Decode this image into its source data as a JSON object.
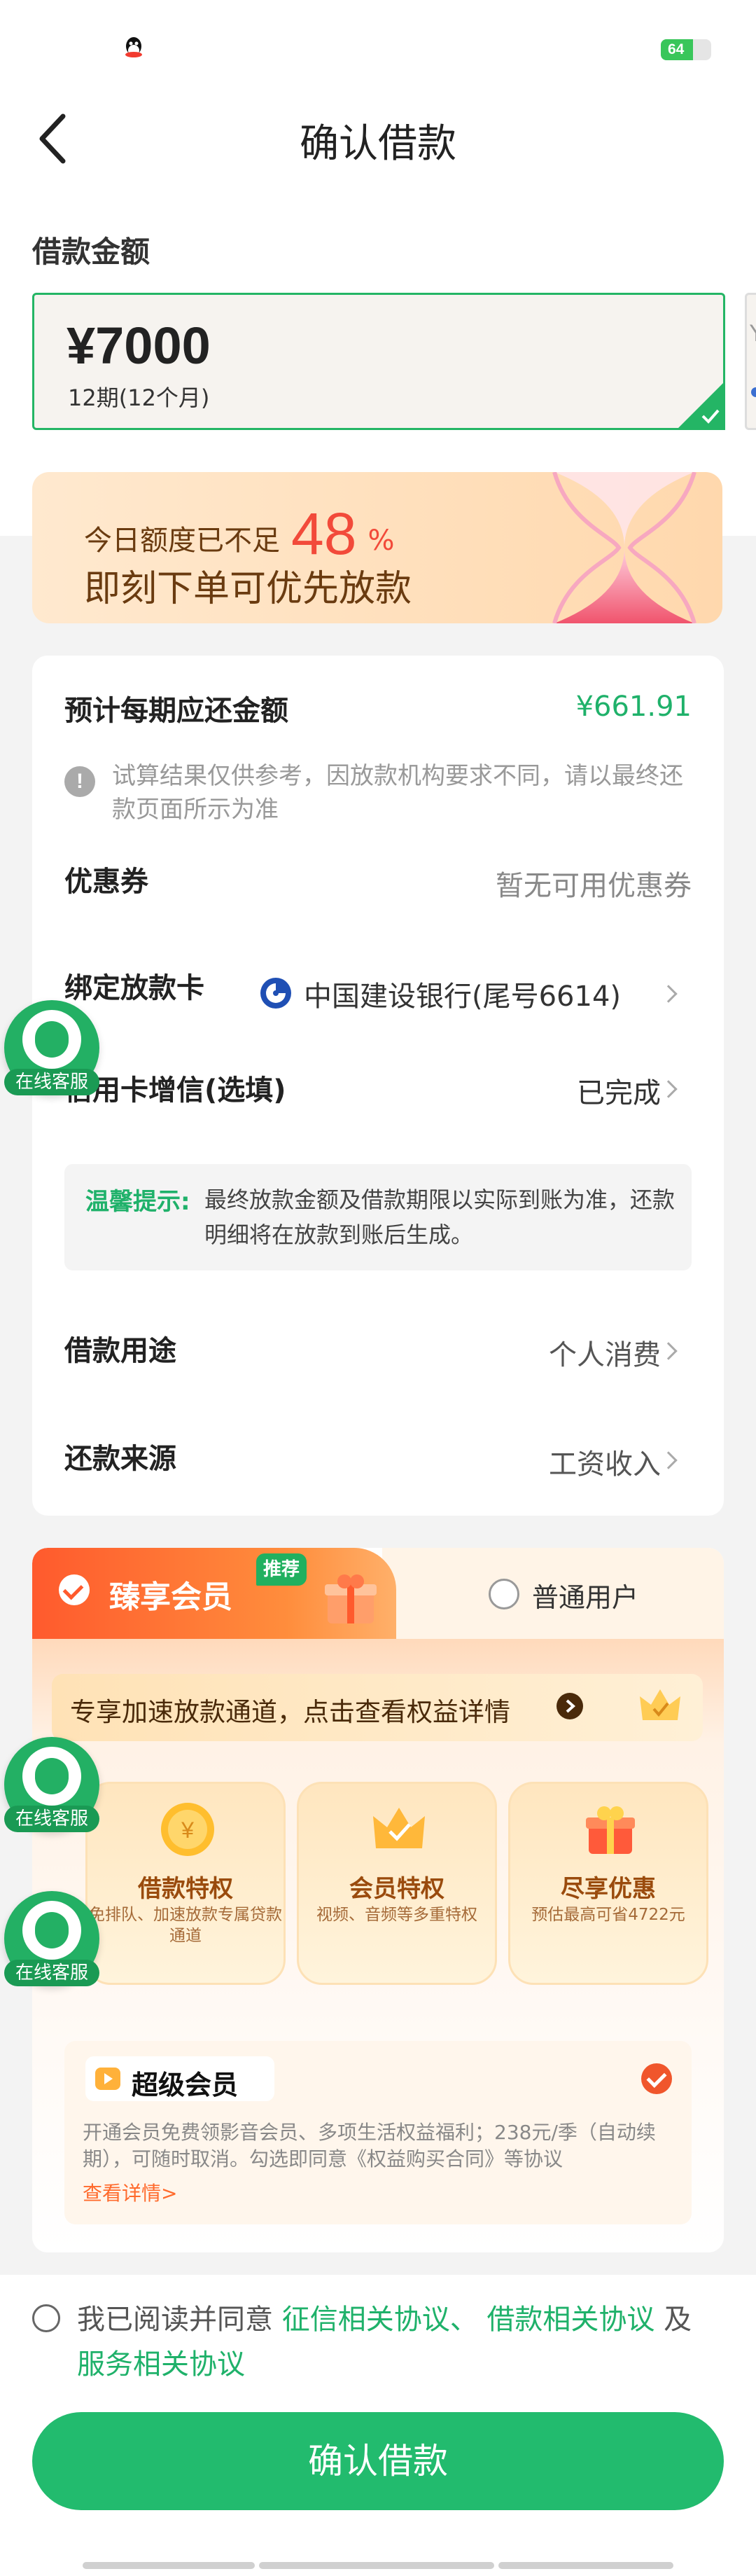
{
  "status_bar": {
    "battery_level": "64",
    "battery_fraction": 0.64,
    "battery_color": "#39c65a"
  },
  "nav": {
    "back_icon": "chevron-left-icon",
    "title": "确认借款"
  },
  "loan_amount": {
    "section_label": "借款金额",
    "amount": "¥7000",
    "term": "12期(12个月)",
    "next_card_peek": "Y"
  },
  "promo": {
    "line1_prefix": "今日额度已不足",
    "percent": "48",
    "percent_unit": "%",
    "line2": "即刻下单可优先放款"
  },
  "details": {
    "repayment_label": "预计每期应还金额",
    "repayment_value": "¥661.91",
    "disclaimer": "试算结果仅供参考，因放款机构要求不同，请以最终还款页面所示为准",
    "coupon_label": "优惠券",
    "coupon_value": "暂无可用优惠券",
    "card_label": "绑定放款卡",
    "card_value": "中国建设银行(尾号6614)",
    "credit_label": "信用卡增信(选填)",
    "credit_value": "已完成",
    "tip_title": "温馨提示:",
    "tip_text": "最终放款金额及借款期限以实际到账为准，还款明细将在放款到账后生成。",
    "purpose_label": "借款用途",
    "purpose_value": "个人消费",
    "source_label": "还款来源",
    "source_value": "工资收入"
  },
  "service": {
    "label": "在线客服"
  },
  "membership": {
    "tab_premium": "臻享会员",
    "tab_badge": "推荐",
    "tab_normal": "普通用户",
    "speed_text": "专享加速放款通道，点击查看权益详情",
    "perks": [
      {
        "title": "借款特权",
        "sub": "免排队、加速放款专属贷款通道"
      },
      {
        "title": "会员特权",
        "sub": "视频、音频等多重特权"
      },
      {
        "title": "尽享优惠",
        "sub": "预估最高可省4722元"
      }
    ],
    "super_title": "超级会员",
    "super_desc": "开通会员免费领影音会员、多项生活权益福利；238元/季（自动续期），可随时取消。勾选即同意《权益购买合同》等协议",
    "super_more": "查看详情>"
  },
  "agreement": {
    "prefix": "我已阅读并同意",
    "link1": "征信相关协议、",
    "link2": "借款相关协议",
    "joiner": "及",
    "link3": "服务相关协议"
  },
  "confirm_button": "确认借款",
  "colors": {
    "brand_green": "#22bb6e",
    "accent_orange": "#ff5a2d",
    "promo_red": "#f24a3a"
  }
}
